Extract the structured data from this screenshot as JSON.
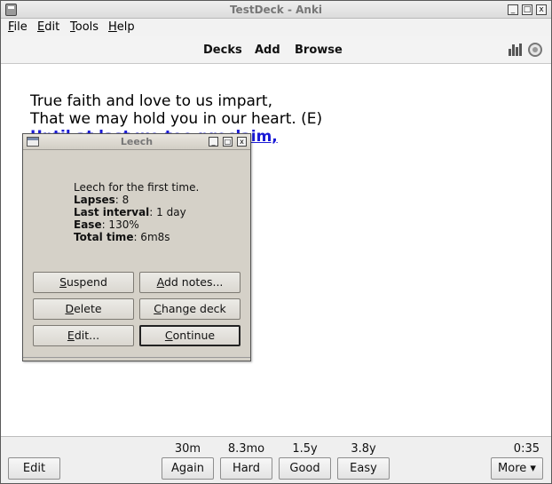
{
  "window": {
    "title": "TestDeck - Anki",
    "controls": [
      "_",
      "□",
      "x"
    ]
  },
  "menu": {
    "items": [
      {
        "label": "File",
        "mnemonic": "F",
        "rest": "ile"
      },
      {
        "label": "Edit",
        "mnemonic": "E",
        "rest": "dit"
      },
      {
        "label": "Tools",
        "mnemonic": "T",
        "rest": "ools"
      },
      {
        "label": "Help",
        "mnemonic": "H",
        "rest": "elp"
      }
    ]
  },
  "toolbar": {
    "decks": "Decks",
    "add": "Add",
    "browse": "Browse",
    "icons": [
      "stats-icon",
      "sync-icon"
    ]
  },
  "card": {
    "lines": [
      "True faith and love to us impart,",
      "That we may hold you in our heart. (E)",
      "Until at last we too proclaim,"
    ],
    "link_color": "#1a1ad6"
  },
  "dialog": {
    "title": "Leech",
    "message": "Leech for the first time.",
    "stats": [
      {
        "label": "Lapses",
        "value": ": 8"
      },
      {
        "label": "Last interval",
        "value": ": 1 day"
      },
      {
        "label": "Ease",
        "value": ": 130%"
      },
      {
        "label": "Total time",
        "value": ": 6m8s"
      }
    ],
    "buttons": {
      "suspend": {
        "mnemonic": "S",
        "rest": "uspend"
      },
      "add_notes": {
        "mnemonic": "A",
        "rest": "dd notes..."
      },
      "delete": {
        "mnemonic": "D",
        "rest": "elete"
      },
      "change_deck": {
        "mnemonic": "C",
        "rest": "hange deck"
      },
      "edit": {
        "mnemonic": "E",
        "rest": "dit..."
      },
      "continue": {
        "mnemonic": "C",
        "rest": "ontinue"
      }
    }
  },
  "bottom": {
    "edit_label": "Edit",
    "timer": "0:35",
    "more_label": "More ▾",
    "answers": [
      {
        "label": "Again",
        "interval": "30m"
      },
      {
        "label": "Hard",
        "interval": "8.3mo"
      },
      {
        "label": "Good",
        "interval": "1.5y"
      },
      {
        "label": "Easy",
        "interval": "3.8y"
      }
    ]
  }
}
